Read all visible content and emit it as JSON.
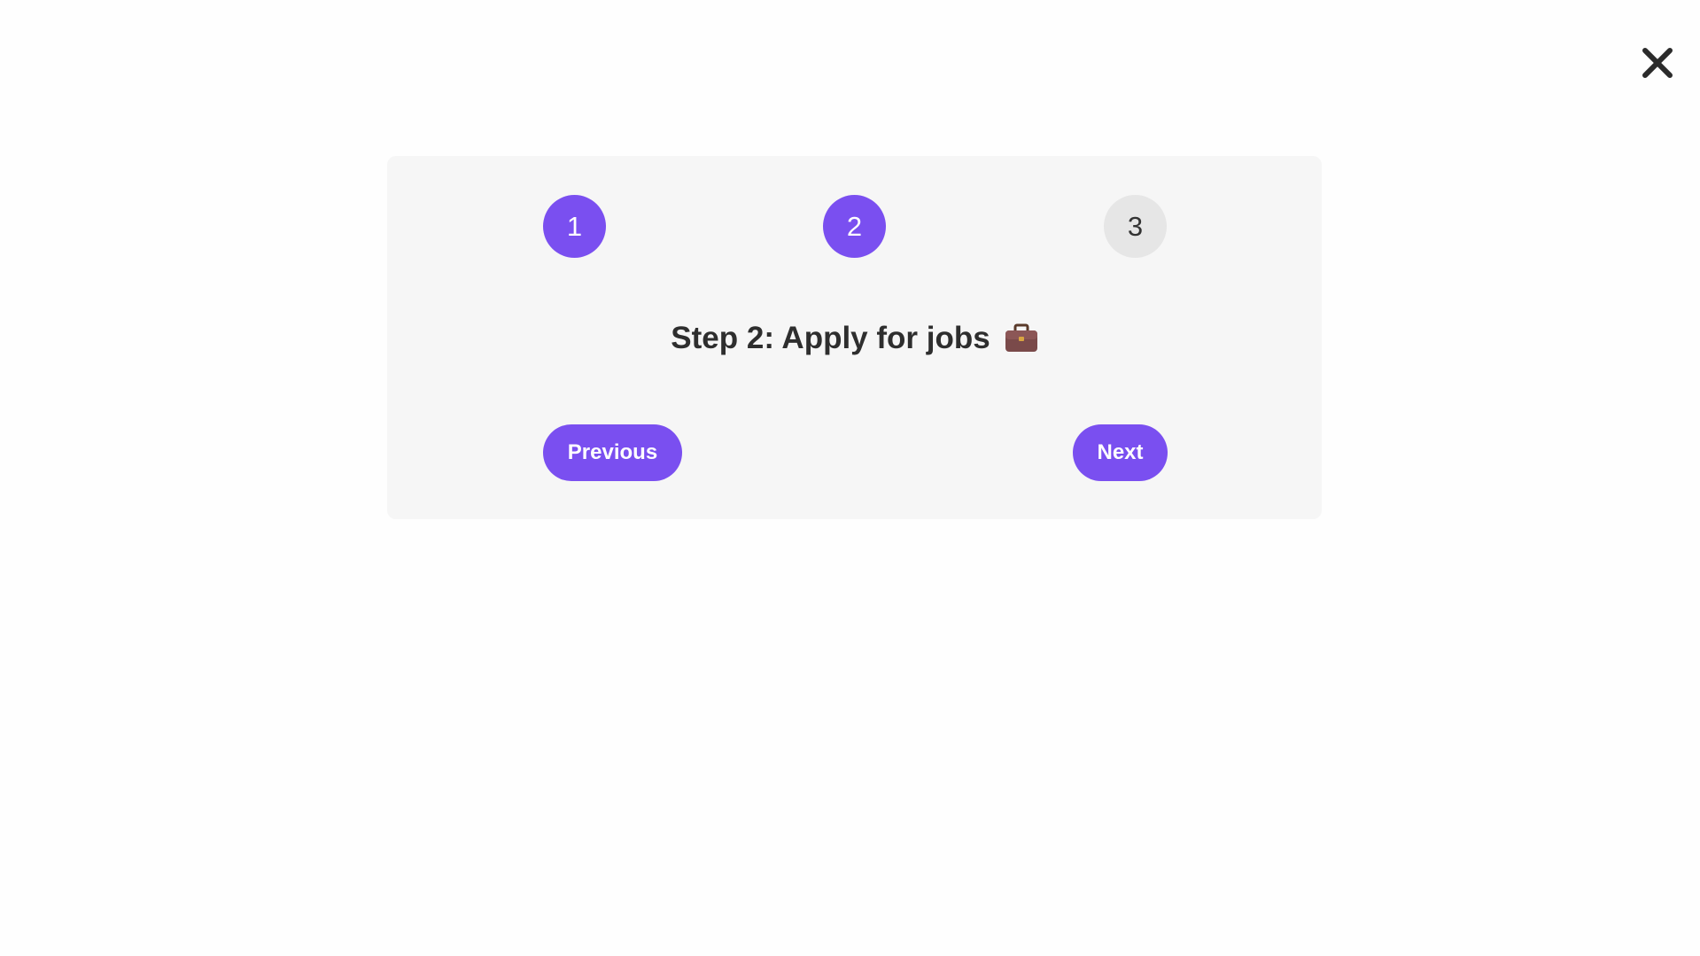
{
  "wizard": {
    "steps": [
      {
        "label": "1",
        "state": "active"
      },
      {
        "label": "2",
        "state": "active"
      },
      {
        "label": "3",
        "state": "inactive"
      }
    ],
    "current_step": 2,
    "title": "Step 2: Apply for jobs",
    "title_icon": "briefcase-icon",
    "previous_label": "Previous",
    "next_label": "Next"
  },
  "close": {
    "icon": "close-icon"
  },
  "colors": {
    "accent": "#7a4ff0",
    "inactive_step": "#e6e6e6",
    "card_background": "#f6f6f6",
    "text": "#2e2e2e"
  }
}
